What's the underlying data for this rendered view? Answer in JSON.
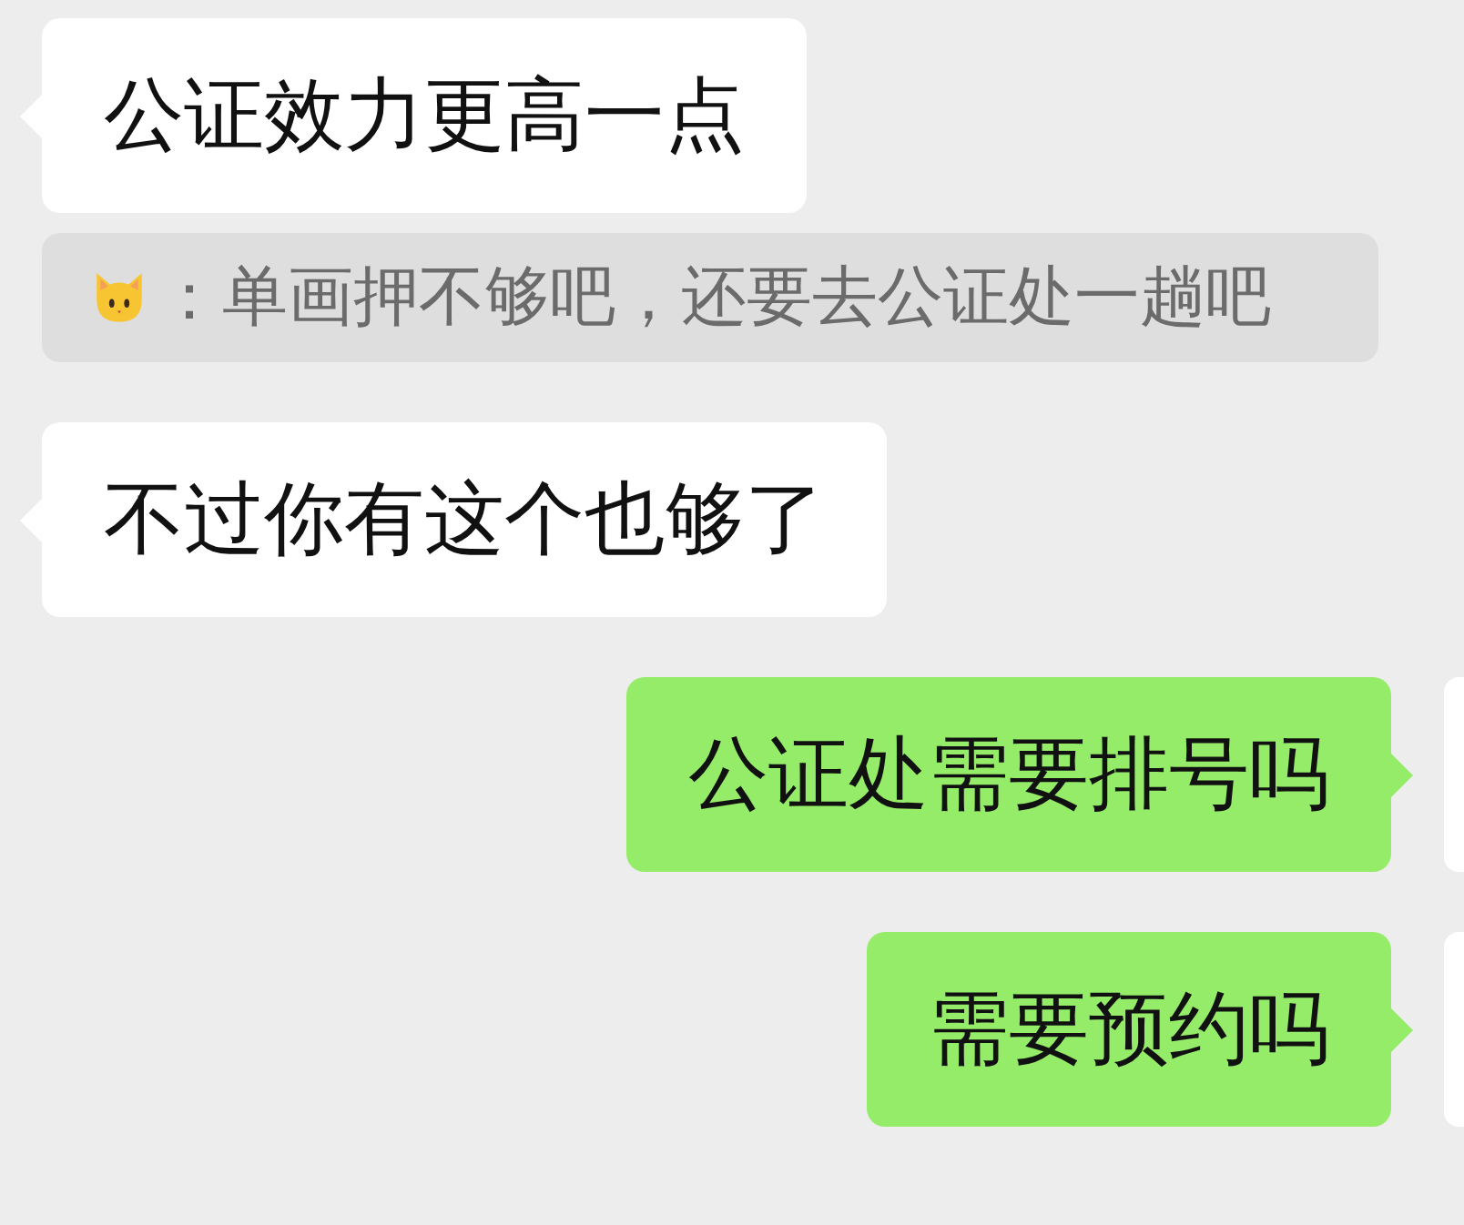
{
  "messages": [
    {
      "kind": "incoming",
      "text": "公证效力更高一点"
    },
    {
      "kind": "quote",
      "text": "：单画押不够吧，还要去公证处一趟吧"
    },
    {
      "kind": "incoming",
      "text": "不过你有这个也够了"
    },
    {
      "kind": "outgoing",
      "text": "公证处需要排号吗"
    },
    {
      "kind": "outgoing",
      "text": "需要预约吗"
    }
  ]
}
